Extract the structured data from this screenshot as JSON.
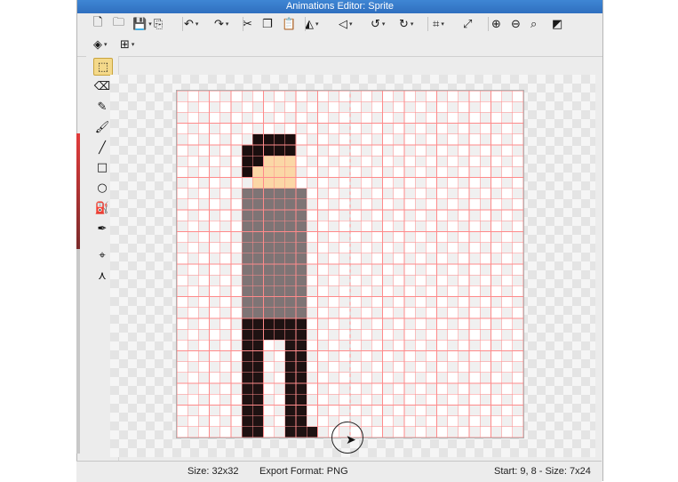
{
  "window": {
    "title": "Animations Editor: Sprite"
  },
  "toolbar": {
    "row1": [
      {
        "name": "new-file-icon",
        "glyph": "🗋"
      },
      {
        "name": "open-folder-icon",
        "glyph": "🗀"
      },
      {
        "name": "save-icon",
        "glyph": "💾"
      },
      {
        "name": "export-icon",
        "glyph": "⎘"
      },
      {
        "name": "undo-icon",
        "glyph": "↶"
      },
      {
        "name": "redo-icon",
        "glyph": "↷"
      },
      {
        "name": "cut-icon",
        "glyph": "✂"
      },
      {
        "name": "copy-icon",
        "glyph": "❐"
      },
      {
        "name": "paste-icon",
        "glyph": "📋"
      },
      {
        "name": "flip-horizontal-icon",
        "glyph": "◭"
      },
      {
        "name": "flip-vertical-icon",
        "glyph": "◁"
      },
      {
        "name": "rotate-left-icon",
        "glyph": "↺"
      },
      {
        "name": "rotate-right-icon",
        "glyph": "↻"
      },
      {
        "name": "crop-icon",
        "glyph": "⌗"
      },
      {
        "name": "resize-icon",
        "glyph": "⤢"
      },
      {
        "name": "zoom-in-icon",
        "glyph": "⊕"
      },
      {
        "name": "zoom-out-icon",
        "glyph": "⊖"
      },
      {
        "name": "zoom-reset-icon",
        "glyph": "⌕"
      },
      {
        "name": "toggle-background-icon",
        "glyph": "◩"
      }
    ],
    "row2": [
      {
        "name": "layers-icon",
        "glyph": "◈"
      },
      {
        "name": "grid-icon",
        "glyph": "⊞"
      }
    ]
  },
  "tools": [
    {
      "name": "select-rect-tool-icon",
      "glyph": "⬚"
    },
    {
      "name": "eraser-tool-icon",
      "glyph": "⌫"
    },
    {
      "name": "pencil-tool-icon",
      "glyph": "✎"
    },
    {
      "name": "brush-tool-icon",
      "glyph": "🖌"
    },
    {
      "name": "line-tool-icon",
      "glyph": "╱"
    },
    {
      "name": "rectangle-tool-icon",
      "glyph": "□"
    },
    {
      "name": "ellipse-tool-icon",
      "glyph": "○"
    },
    {
      "name": "fill-bucket-tool-icon",
      "glyph": "⛽"
    },
    {
      "name": "eyedropper-tool-icon",
      "glyph": "✒"
    },
    {
      "name": "pivot-point-tool-icon",
      "glyph": "⌖"
    },
    {
      "name": "anchor-points-tool-icon",
      "glyph": "⋏"
    }
  ],
  "sprite": {
    "size": 32,
    "colors": {
      "hair": "#1a0e0e",
      "skin": "#fbd7a6",
      "shirt": "#7e7475",
      "pants": "#1e1212",
      "grid": "#ff8a8a"
    },
    "pixels": {
      "hair": [
        [
          7,
          4
        ],
        [
          8,
          4
        ],
        [
          9,
          4
        ],
        [
          10,
          4
        ],
        [
          6,
          5
        ],
        [
          7,
          5
        ],
        [
          8,
          5
        ],
        [
          9,
          5
        ],
        [
          10,
          5
        ],
        [
          6,
          6
        ],
        [
          7,
          6
        ],
        [
          6,
          7
        ]
      ],
      "skin": [
        [
          8,
          6
        ],
        [
          9,
          6
        ],
        [
          10,
          6
        ],
        [
          7,
          7
        ],
        [
          8,
          7
        ],
        [
          9,
          7
        ],
        [
          10,
          7
        ],
        [
          7,
          8
        ],
        [
          8,
          8
        ],
        [
          9,
          8
        ],
        [
          10,
          8
        ]
      ],
      "shirt_rect": [
        6,
        9,
        6,
        12
      ],
      "shirt_top": [
        [
          7,
          8
        ],
        [
          8,
          8
        ],
        [
          9,
          8
        ],
        [
          10,
          8
        ]
      ],
      "pants_rect": [
        6,
        21,
        6,
        2
      ],
      "legs": [
        [
          6,
          23,
          2,
          8
        ],
        [
          10,
          23,
          2,
          8
        ]
      ],
      "feet": [
        [
          6,
          31,
          2,
          1
        ],
        [
          10,
          31,
          3,
          1
        ]
      ]
    }
  },
  "status": {
    "size": "Size: 32x32",
    "format": "Export Format: PNG",
    "selection": "Start: 9, 8 - Size: 7x24"
  }
}
